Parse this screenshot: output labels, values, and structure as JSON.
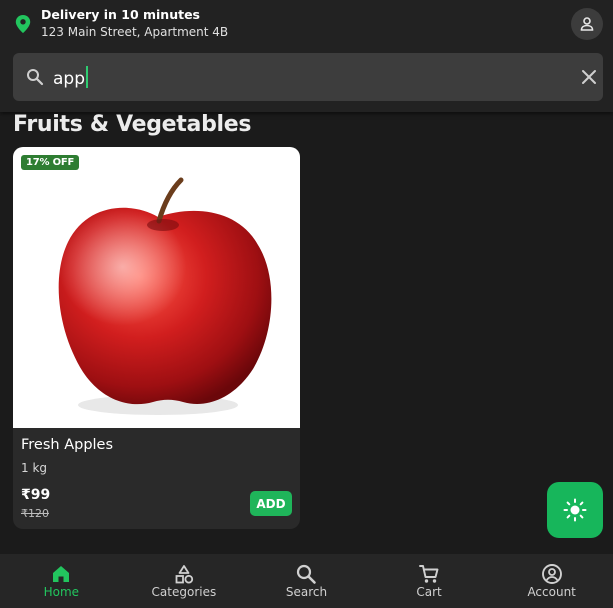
{
  "header": {
    "delivery_title": "Delivery in 10 minutes",
    "delivery_address": "123 Main Street, Apartment 4B",
    "location_icon": "location-pin-icon",
    "profile_icon": "person-icon"
  },
  "search": {
    "value": "app",
    "search_icon": "search-icon",
    "clear_icon": "close-icon"
  },
  "section": {
    "title": "Fruits & Vegetables"
  },
  "products": [
    {
      "discount": "17% OFF",
      "name": "Fresh Apples",
      "quantity": "1 kg",
      "price": "₹99",
      "mrp": "₹120",
      "add_label": "ADD"
    }
  ],
  "theme_toggle": {
    "icon": "sun-icon"
  },
  "bottom_nav": {
    "items": [
      {
        "label": "Home",
        "icon": "home-icon",
        "active": true
      },
      {
        "label": "Categories",
        "icon": "categories-icon",
        "active": false
      },
      {
        "label": "Search",
        "icon": "search-icon",
        "active": false
      },
      {
        "label": "Cart",
        "icon": "cart-icon",
        "active": false
      },
      {
        "label": "Account",
        "icon": "account-circle-icon",
        "active": false
      }
    ]
  },
  "colors": {
    "accent": "#22c55e",
    "background": "#1b1b1b",
    "card": "#2a2a2a",
    "discount_badge": "#2e7d32"
  }
}
